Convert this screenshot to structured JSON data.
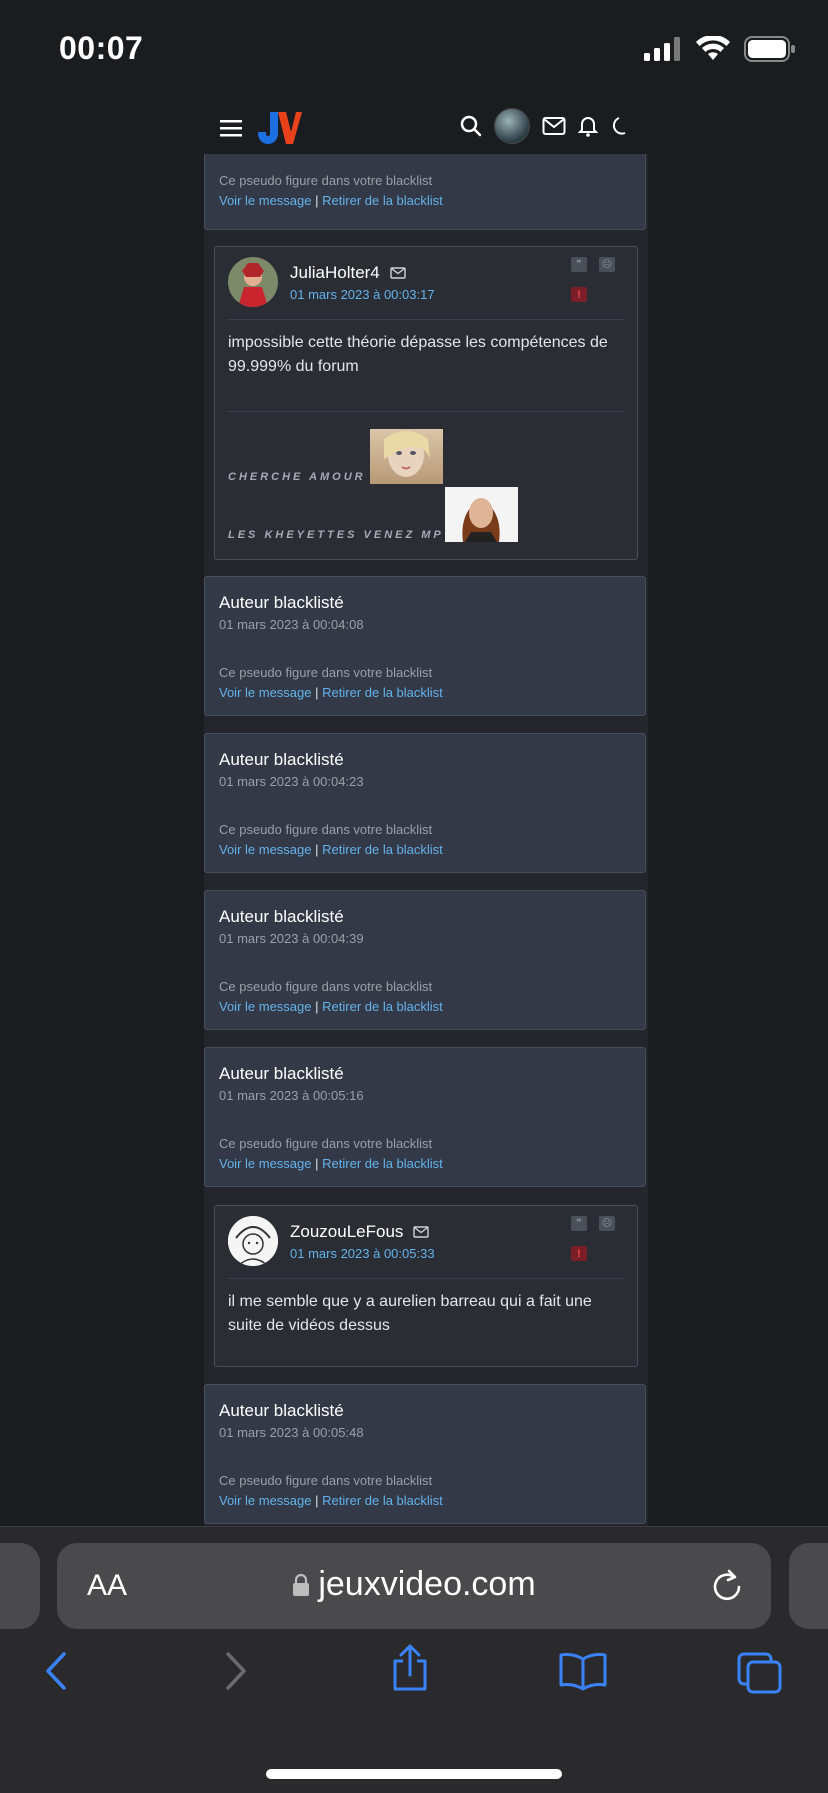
{
  "status": {
    "time": "00:07"
  },
  "header": {
    "logo": "JV",
    "icons": [
      "menu-icon",
      "search-icon",
      "avatar",
      "mail-icon",
      "bell-icon",
      "moon-icon"
    ]
  },
  "blacklist": {
    "note": "Ce pseudo figure dans votre blacklist",
    "view_link": "Voir le message",
    "separator": "|",
    "remove_link": "Retirer de la blacklist",
    "title": "Auteur blacklisté"
  },
  "cards": [
    {
      "kind": "blacklist-partial"
    },
    {
      "kind": "post",
      "author": "JuliaHolter4",
      "date": "01 mars 2023 à 00:03:17",
      "body": "impossible cette théorie dépasse les compétences de 99.999% du forum",
      "signature": [
        "CHERCHE AMOUR",
        "LES KHEYETTES VENEZ MP"
      ]
    },
    {
      "kind": "blacklist",
      "date": "01 mars 2023 à 00:04:08"
    },
    {
      "kind": "blacklist",
      "date": "01 mars 2023 à 00:04:23"
    },
    {
      "kind": "blacklist",
      "date": "01 mars 2023 à 00:04:39"
    },
    {
      "kind": "blacklist",
      "date": "01 mars 2023 à 00:05:16"
    },
    {
      "kind": "post",
      "author": "ZouzouLeFous",
      "date": "01 mars 2023 à 00:05:33",
      "body": "il me semble que y a aurelien barreau qui a fait une suite de vidéos dessus"
    },
    {
      "kind": "blacklist",
      "date": "01 mars 2023 à 00:05:48"
    }
  ],
  "browser": {
    "aa_label": "AA",
    "url": "jeuxvideo.com"
  },
  "colors": {
    "link": "#63b3ed",
    "card": "#333946",
    "post": "#2a2d33",
    "accent_red": "#e8421c",
    "accent_blue": "#1b6fe0"
  }
}
